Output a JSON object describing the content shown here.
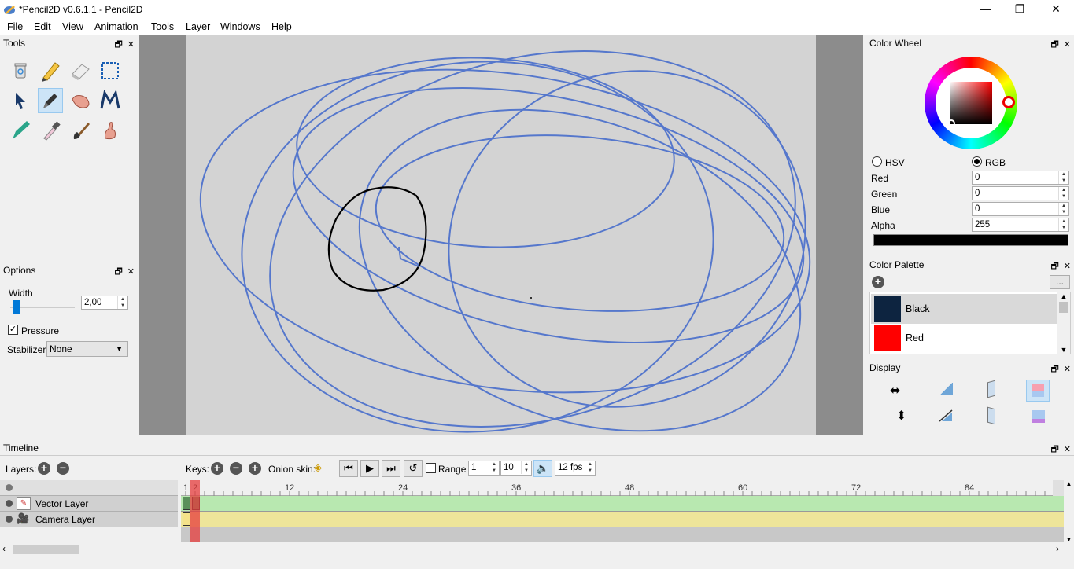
{
  "window": {
    "title": "*Pencil2D v0.6.1.1 - Pencil2D",
    "minimize": "—",
    "maximize": "❐",
    "close": "✕"
  },
  "menu": [
    "File",
    "Edit",
    "View",
    "Animation",
    "Tools",
    "Layer",
    "Windows",
    "Help"
  ],
  "tools_panel": {
    "title": "Tools",
    "undock": "🗗",
    "close": "✕"
  },
  "options_panel": {
    "title": "Options",
    "width_label": "Width",
    "width_value": "2,00",
    "width_slider_fraction": 0.08,
    "pressure_label": "Pressure",
    "pressure_checked": "✓",
    "stabilizer_label": "Stabilizer",
    "stabilizer_value": "None"
  },
  "color_wheel": {
    "title": "Color Wheel",
    "hsv_label": "HSV",
    "rgb_label": "RGB",
    "red_label": "Red",
    "red_value": "0",
    "green_label": "Green",
    "green_value": "0",
    "blue_label": "Blue",
    "blue_value": "0",
    "alpha_label": "Alpha",
    "alpha_value": "255",
    "current_color": "#000000"
  },
  "color_palette": {
    "title": "Color Palette",
    "more": "...",
    "items": [
      {
        "name": "Black",
        "color": "#0d2440"
      },
      {
        "name": "Red",
        "color": "#ff0000"
      }
    ]
  },
  "display_panel": {
    "title": "Display"
  },
  "timeline": {
    "title": "Timeline",
    "layers_label": "Layers:",
    "keys_label": "Keys:",
    "onion_label": "Onion skin:",
    "range_label": "Range",
    "range_start": "1",
    "range_end": "10",
    "fps": "12 fps",
    "ruler": [
      "1",
      "2",
      "12",
      "24",
      "36",
      "48",
      "60",
      "72",
      "84"
    ],
    "layers": [
      {
        "name": "Vector Layer",
        "color": "#b8e8b0"
      },
      {
        "name": "Camera Layer",
        "color": "#eee59a"
      }
    ]
  }
}
